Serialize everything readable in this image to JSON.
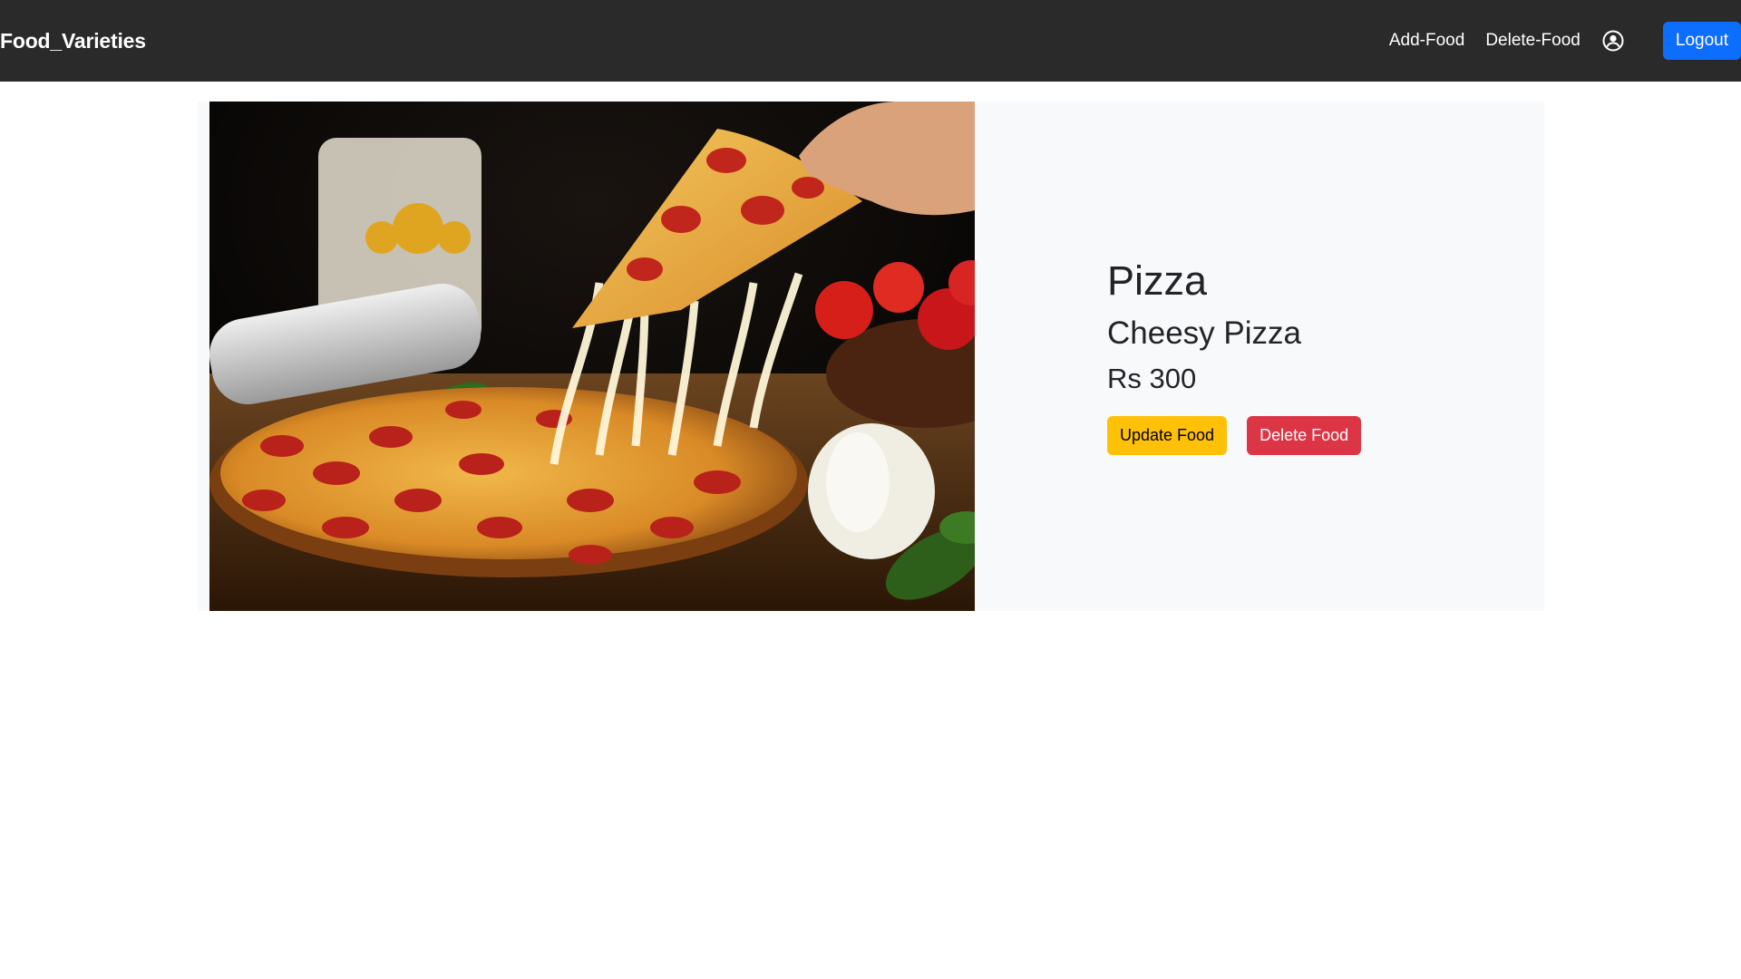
{
  "navbar": {
    "brand": "Food_Varieties",
    "links": [
      {
        "label": "Add-Food"
      },
      {
        "label": "Delete-Food"
      }
    ],
    "profile_icon": "user-circle-icon",
    "logout_label": "Logout"
  },
  "food": {
    "image_alt": "pizza-photo",
    "name": "Pizza",
    "description": "Cheesy Pizza",
    "price": "Rs 300",
    "update_label": "Update Food",
    "delete_label": "Delete Food"
  },
  "colors": {
    "navbar_bg": "#2b2a2b",
    "primary": "#0d6efd",
    "warning": "#ffc107",
    "danger": "#dc3545",
    "card_bg": "#f8f9fa"
  }
}
